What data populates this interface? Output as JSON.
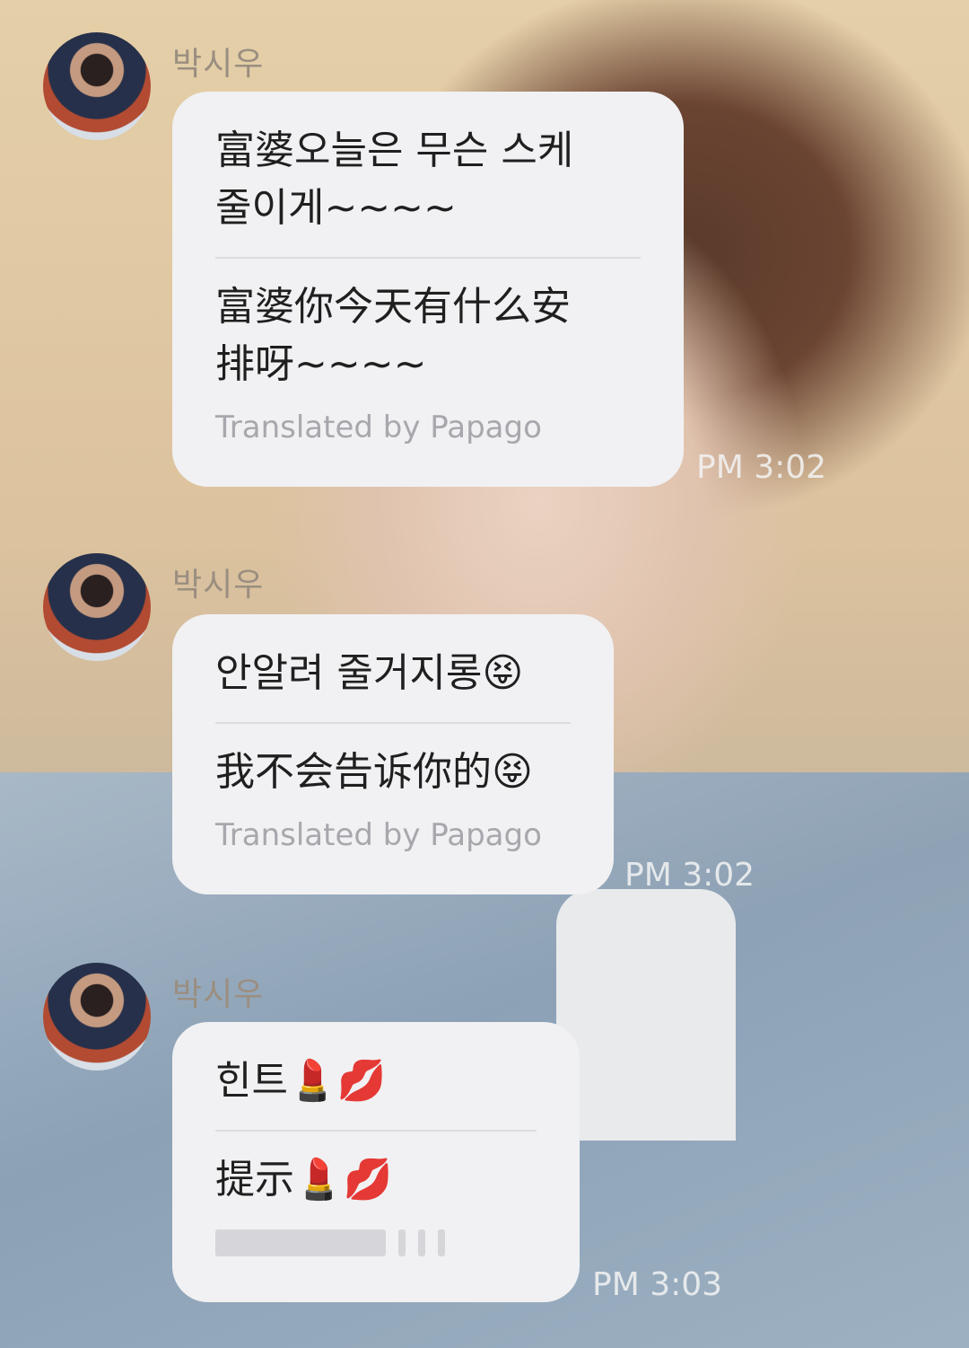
{
  "messages": [
    {
      "sender": "박시우",
      "original": "富婆오늘은 무슨 스케\n줄이게~~~~",
      "translation": "富婆你今天有什么安\n排呀~~~~",
      "translated_by": "Translated by Papago",
      "time": "PM 3:02"
    },
    {
      "sender": "박시우",
      "original": "안알려 줄거지롱😝",
      "translation": "我不会告诉你的😝",
      "translated_by": "Translated by Papago",
      "time": "PM 3:02"
    },
    {
      "sender": "박시우",
      "original": "힌트💄💋",
      "translation": "提示💄💋",
      "translated_by": "",
      "time": "PM 3:03"
    }
  ]
}
